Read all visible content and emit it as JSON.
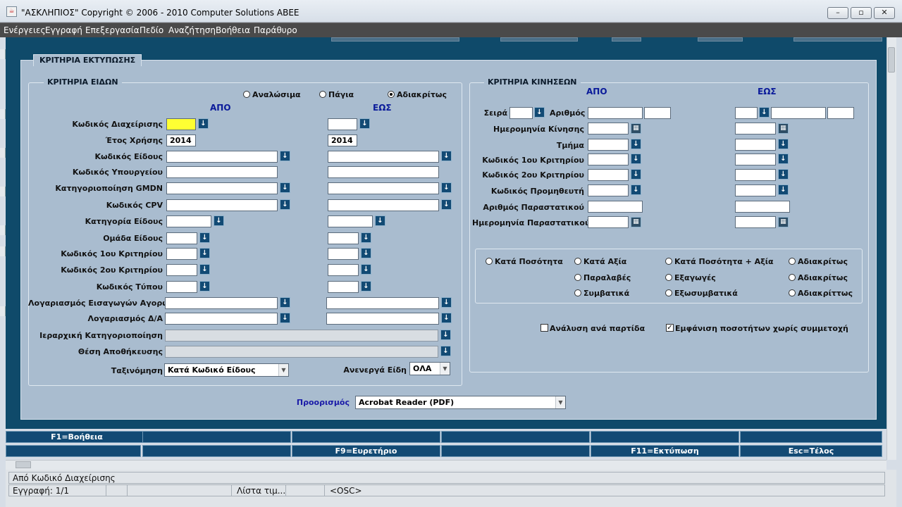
{
  "window": {
    "title": "\"ΑΣΚΛΗΠΙΟΣ\" Copyright © 2006 - 2010 Computer Solutions ABEE",
    "minimize": "–",
    "maximize": "▫",
    "close": "✕"
  },
  "menu": [
    "Ενέργειες",
    "Εγγραφή",
    "Επεξεργασία",
    "Πεδίο",
    "Αναζήτηση",
    "Βοήθεια",
    "Παράθυρο"
  ],
  "panel": {
    "tab": "ΚΡΙΤΗΡΙΑ ΕΚΤΥΠΩΣΗΣ"
  },
  "items": {
    "title": "ΚΡΙΤΗΡΙΑ ΕΙΔΩΝ",
    "radios": [
      {
        "label": "Αναλώσιμα",
        "selected": false
      },
      {
        "label": "Πάγια",
        "selected": false
      },
      {
        "label": "Αδιακρίτως",
        "selected": true
      }
    ],
    "from": "ΑΠΟ",
    "to": "ΕΩΣ",
    "labels": [
      "Κωδικός Διαχείρισης",
      "Έτος Χρήσης",
      "Κωδικός Είδους",
      "Κωδικός Υπουργείου",
      "Κατηγοριοποίηση GMDN",
      "Κωδικός CPV",
      "Κατηγορία Είδους",
      "Ομάδα Είδους",
      "Κωδικός 1ου Κριτηρίου",
      "Κωδικός 2ου Κριτηρίου",
      "Κωδικός Τύπου",
      "Λογαριασμός Εισαγωγών Αγορών",
      "Λογαριασμός Δ/Α",
      "Ιεραρχική Κατηγοριοποίηση",
      "Θέση Αποθήκευσης"
    ],
    "year_from": "2014",
    "year_to": "2014",
    "sort_label": "Ταξινόμηση",
    "sort_value": "Κατά Κωδικό Είδους",
    "inactive_label": "Ανενεργά Είδη",
    "inactive_value": "ΟΛΑ"
  },
  "moves": {
    "title": "ΚΡΙΤΗΡΙΑ ΚΙΝΗΣΕΩΝ",
    "from": "ΑΠΟ",
    "to": "ΕΩΣ",
    "series": "Σειρά",
    "number": "Αριθμός",
    "labels": [
      "Ημερομηνία Κίνησης",
      "Τμήμα",
      "Κωδικός 1ου Κριτηρίου",
      "Κωδικός 2ου Κριτηρίου",
      "Κωδικός Προμηθευτή",
      "Αριθμός Παραστατικού",
      "Ημερομηνία Παραστατικού"
    ],
    "radio_g1": [
      {
        "label": "Κατά Ποσότητα",
        "selected": false
      }
    ],
    "radio_g2": [
      {
        "label": "Κατά Αξία",
        "selected": false
      },
      {
        "label": "Παραλαβές",
        "selected": false
      },
      {
        "label": "Συμβατικά",
        "selected": false
      }
    ],
    "radio_g3": [
      {
        "label": "Κατά Ποσότητα + Αξία",
        "selected": false
      },
      {
        "label": "Εξαγωγές",
        "selected": false
      },
      {
        "label": "Εξωσυμβατικά",
        "selected": false
      }
    ],
    "radio_g4": [
      {
        "label": "Αδιακρίτως",
        "selected": false
      },
      {
        "label": "Αδιακρίτως",
        "selected": false
      },
      {
        "label": "Αδιακρίττως",
        "selected": false
      }
    ],
    "chk_lot": {
      "label": "Ανάλυση ανά παρτίδα",
      "checked": false
    },
    "chk_zero": {
      "label": "Εμφάνιση ποσοτήτων χωρίς συμμετοχή",
      "checked": true
    }
  },
  "destination": {
    "label": "Προορισμός",
    "value": "Acrobat Reader (PDF)"
  },
  "fkeys": {
    "row1": [
      "F1=Βοήθεια",
      "",
      "",
      "",
      "",
      ""
    ],
    "row2": [
      "",
      "",
      "F9=Ευρετήριο",
      "",
      "F11=Εκτύπωση",
      "Esc=Τέλος"
    ]
  },
  "status": {
    "hint": "Από Κωδικό Διαχείρισης",
    "record": "Εγγραφή: 1/1",
    "list": "Λίστα τιμ...",
    "osc": "<OSC>"
  },
  "icons": {
    "lov": "↓",
    "cal": "▦",
    "check": "✓",
    "arrow": "▼"
  }
}
